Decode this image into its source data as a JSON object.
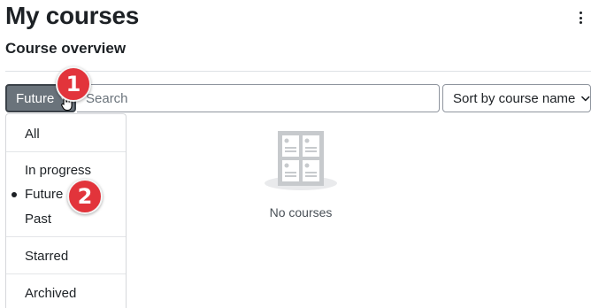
{
  "header": {
    "title": "My courses",
    "more_icon": "kebab-vertical-icon"
  },
  "course_overview": {
    "title": "Course overview",
    "filter": {
      "selected_label": "Future",
      "options": [
        {
          "label": "All"
        },
        {
          "label": "In progress"
        },
        {
          "label": "Future",
          "selected": true
        },
        {
          "label": "Past"
        },
        {
          "label": "Starred"
        },
        {
          "label": "Archived"
        }
      ]
    },
    "search": {
      "placeholder": "Search",
      "value": ""
    },
    "sort": {
      "label": "Sort by course name"
    },
    "empty_state": {
      "text": "No courses"
    }
  },
  "annotations": {
    "step1": "1",
    "step2": "2"
  },
  "colors": {
    "filter_button_bg": "#6a737b",
    "badge_red": "#e2343b",
    "text": "#1d2125",
    "muted_text": "#495057",
    "illustration_gray": "#c7cacd"
  }
}
